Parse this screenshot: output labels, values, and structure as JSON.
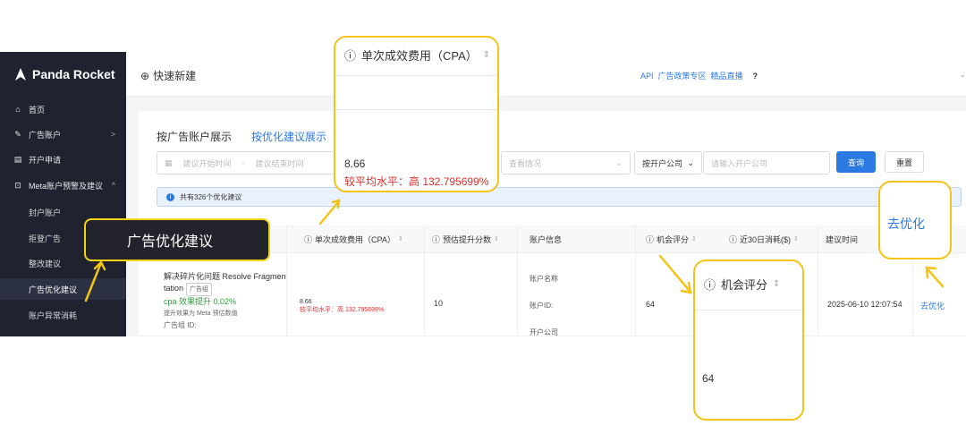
{
  "brand": {
    "name": "Panda Rocket"
  },
  "sidebar": {
    "items": [
      {
        "label": "首页",
        "icon": "home-icon"
      },
      {
        "label": "广告账户",
        "icon": "edit-icon",
        "chevron": ">"
      },
      {
        "label": "开户申请",
        "icon": "form-icon"
      },
      {
        "label": "Meta账户预警及建议",
        "icon": "alert-icon",
        "chevron": "^"
      }
    ],
    "subitems": [
      {
        "label": "封户账户"
      },
      {
        "label": "拒登广告"
      },
      {
        "label": "整改建议"
      },
      {
        "label": "广告优化建议",
        "active": true
      },
      {
        "label": "账户异常消耗"
      }
    ]
  },
  "header": {
    "quick_create": "快速新建",
    "links": [
      "API",
      "广告政策专区",
      "精品直播"
    ],
    "help": "?"
  },
  "tabs": {
    "by_account": "按广告账户展示",
    "by_suggestion": "按优化建议展示"
  },
  "filters": {
    "date_start": "建议开始时间",
    "date_sep": "-",
    "date_end": "建议结束时间",
    "status": "查看情况",
    "company_select": "按开户公司",
    "company_input": "请输入开户公司",
    "query": "查询",
    "reset": "重置"
  },
  "info": {
    "text": "共有326个优化建议"
  },
  "table": {
    "headers": {
      "cpa": "单次成效费用（CPA）",
      "score_up": "预估提升分数",
      "account": "账户信息",
      "opportunity": "机会评分",
      "spend30": "近30日消耗($)",
      "time": "建议时间"
    },
    "row": {
      "title_a": "解决碎片化问题 Resolve Fragmen",
      "title_b": "tation",
      "tag": "广告组",
      "cpa_lift": "cpa 效果提升 0.02%",
      "note": "提升效果为 Meta 预估数值",
      "adgroup": "广告组 ID:",
      "cpa_value": "8.66",
      "cpa_compare": "较平均水平：高 132.795699%",
      "score_up": "10",
      "account_name": "账户名称",
      "account_id": "账户ID:",
      "company": "开户公司",
      "opportunity": "64",
      "time": "2025-06-10 12:07:54",
      "action": "去优化"
    }
  },
  "annotations": {
    "banner": "广告优化建议",
    "cpa_header": "单次成效费用（CPA）",
    "cpa_value": "8.66",
    "cpa_compare": "较平均水平：高 132.795699%",
    "score_header": "机会评分",
    "score_value": "64",
    "action_label": "去优化"
  },
  "colors": {
    "accent": "#2a7ae2",
    "highlight": "#f3c316",
    "sidebar": "#1f2330",
    "alert": "#d9302b"
  }
}
